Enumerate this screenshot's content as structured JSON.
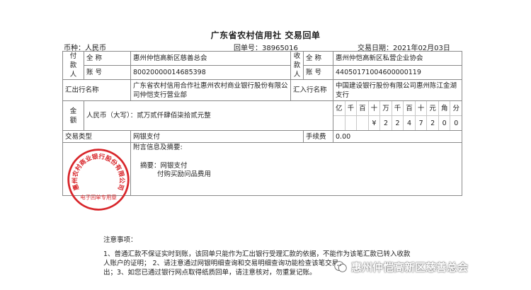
{
  "document": {
    "title": "广东省农村信用社 交易回单",
    "currency": "币种：人民币",
    "receipt_no": "回单号：38965016",
    "trade_date": "交易日期：2021年02月03日"
  },
  "payer": {
    "side_label": [
      "付",
      "款",
      "人"
    ],
    "name_label": "全 称",
    "name": "惠州仲恺高新区慈善总会",
    "account_label": "账 号",
    "account": "80020000014685398",
    "bank_label": "汇出行名称",
    "bank": "广东省农村信用合作社惠州农村商业银行股份有限公司仲恺支行营业部"
  },
  "payee": {
    "side_label": [
      "收",
      "款",
      "人"
    ],
    "name_label": "全 称",
    "name": "惠州仲恺高新区私营企业协会",
    "account_label": "账 号",
    "account": "44050171004600000119",
    "bank_label": "汇入行名称",
    "bank": "中国建设银行股份有限公司惠州陈江金湖支行"
  },
  "amount": {
    "side_label": [
      "金",
      "额"
    ],
    "words": "人民币（大写）：贰万贰仟肆佰柒拾贰元整",
    "units": [
      "亿",
      "千",
      "百",
      "十",
      "万",
      "千",
      "百",
      "十",
      "元",
      "角",
      "分"
    ],
    "digits": [
      "",
      "",
      "",
      "¥",
      "2",
      "2",
      "4",
      "7",
      "2",
      "0",
      "0"
    ]
  },
  "transaction": {
    "type_label": "交易类型",
    "type": "网银支付",
    "fee_label": "手续费",
    "fee": "0.00"
  },
  "postscript": {
    "label": "附言信息及摘要:",
    "summary_line1": "摘要：网银支付",
    "summary_line2": "付购买励问品费用"
  },
  "seal": {
    "text": "惠州农村商业银行股份有限公司",
    "bottom_text": "电子回单专用章",
    "color": "#d8262b"
  },
  "notes": {
    "title": "注意事项：",
    "line1": "1、普通汇款不保证实时到账，该回单只能作为汇出银行受理汇款的依据，不能作为该笔汇款已转入收款",
    "line2": "人账户的证明； 2、请注意通过网银明细查询和交易明细查询功能检查该笔交易",
    "line3": "出；3、如您已通过银行网点取得纸质回单，请注意核对，勿重复记账。"
  },
  "watermark": {
    "text": "惠州仲恺高新区慈善总会"
  }
}
